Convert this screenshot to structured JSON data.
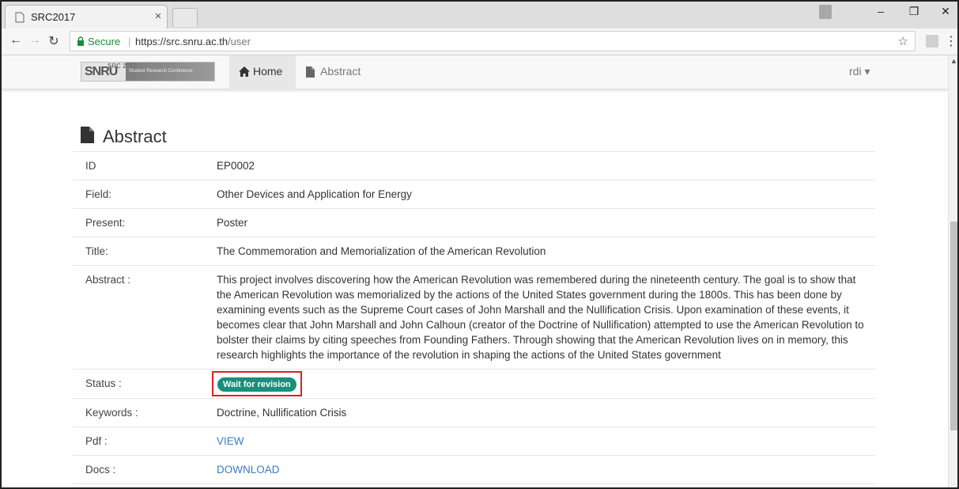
{
  "browser": {
    "tab_title": "SRC2017",
    "tab_close": "×",
    "secure_label": "Secure",
    "url_base": "https://src.snru.ac.th",
    "url_path": "/user",
    "star": "☆"
  },
  "site": {
    "logo_main": "SNRU",
    "logo_year": "SRC 2017",
    "logo_sub": "Student Research Conference",
    "nav": {
      "home_label": "Home",
      "abstract_label": "Abstract",
      "user_label": "rdi ▾"
    }
  },
  "page": {
    "heading": "Abstract",
    "rows": {
      "id": {
        "label": "ID",
        "value": "EP0002"
      },
      "field": {
        "label": "Field:",
        "value": "Other Devices and Application for Energy"
      },
      "present": {
        "label": "Present:",
        "value": "Poster"
      },
      "title": {
        "label": "Title:",
        "value": "The Commemoration and Memorialization of the American Revolution"
      },
      "abstract": {
        "label": "Abstract :",
        "value": "This project involves discovering how the American Revolution was remembered during the nineteenth century. The goal is to show that the American Revolution was memorialized by the actions of the United States government during the 1800s. This has been done by examining events such as the Supreme Court cases of John Marshall and the Nullification Crisis. Upon examination of these events, it becomes clear that John Marshall and John Calhoun (creator of the Doctrine of Nullification) attempted to use the American Revolution to bolster their claims by citing speeches from Founding Fathers. Through showing that the American Revolution lives on in memory, this research highlights the importance of the revolution in shaping the actions of the United States government"
      },
      "status": {
        "label": "Status :",
        "value": "Wait for revision",
        "color": "#1a8f7a"
      },
      "keywords": {
        "label": "Keywords :",
        "value": "Doctrine, Nullification Crisis"
      },
      "pdf": {
        "label": "Pdf :",
        "value": "VIEW"
      },
      "docs": {
        "label": "Docs :",
        "value": "DOWNLOAD"
      }
    }
  },
  "colors": {
    "link": "#3a7dc2",
    "highlight_box": "#e02020",
    "status_badge": "#1a8f7a"
  }
}
